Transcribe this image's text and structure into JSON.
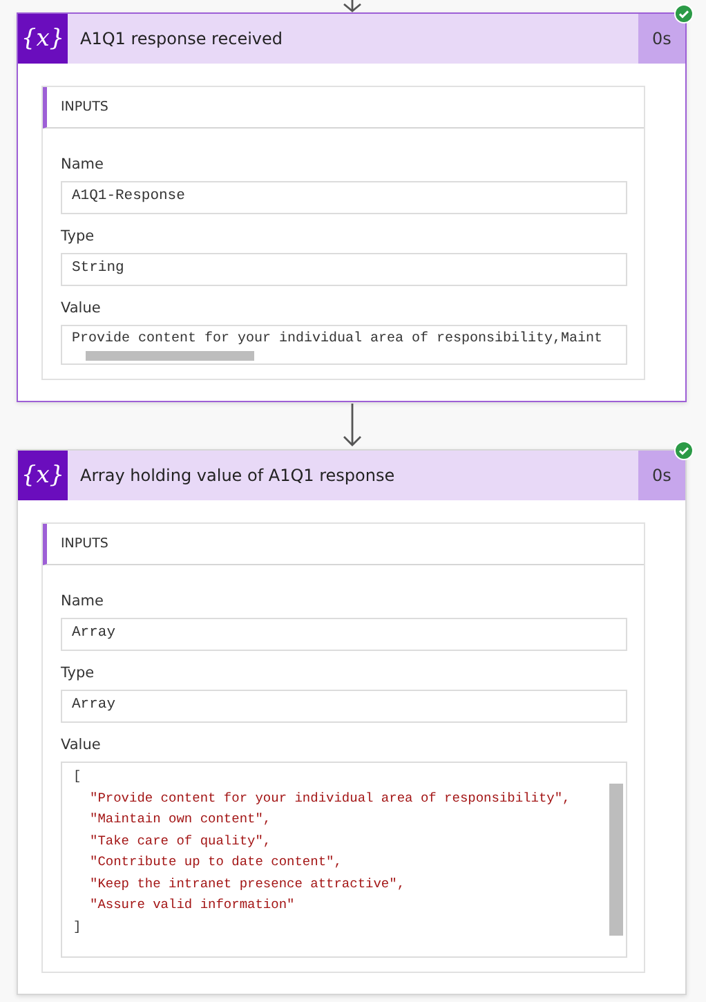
{
  "cards": [
    {
      "icon": "{x}",
      "title": "A1Q1 response received",
      "duration": "0s",
      "selected": true,
      "succeeded": true,
      "section": "INPUTS",
      "fields": [
        {
          "label": "Name",
          "kind": "text",
          "value": "A1Q1-Response"
        },
        {
          "label": "Type",
          "kind": "text",
          "value": "String"
        },
        {
          "label": "Value",
          "kind": "scroll",
          "value": "Provide content for your individual area of responsibility,Maint"
        }
      ]
    },
    {
      "icon": "{x}",
      "title": "Array holding value of A1Q1 response",
      "duration": "0s",
      "selected": false,
      "succeeded": true,
      "section": "INPUTS",
      "fields": [
        {
          "label": "Name",
          "kind": "text",
          "value": "Array"
        },
        {
          "label": "Type",
          "kind": "text",
          "value": "Array"
        },
        {
          "label": "Value",
          "kind": "code",
          "open": "[",
          "close": "]",
          "lines": [
            "\"Provide content for your individual area of responsibility\",",
            "\"Maintain own content\",",
            "\"Take care of quality\",",
            "\"Contribute up to date content\",",
            "\"Keep the intranet presence attractive\",",
            "\"Assure valid information\""
          ]
        }
      ]
    }
  ]
}
